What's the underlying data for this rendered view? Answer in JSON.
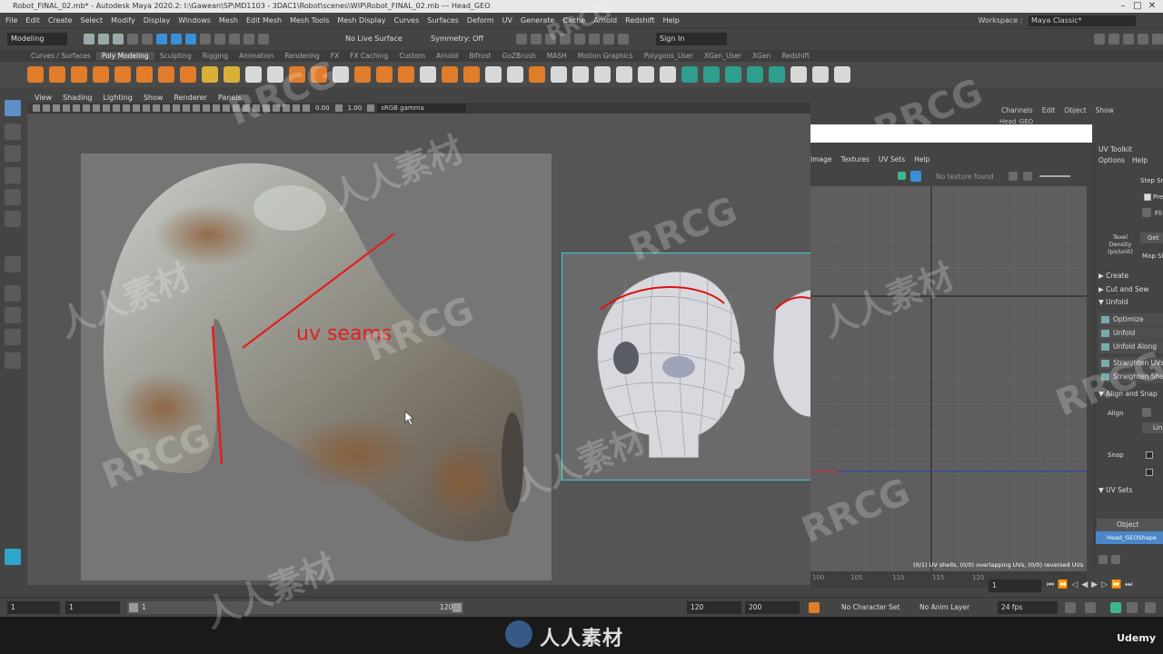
{
  "window": {
    "title": "Robot_FINAL_02.mb* - Autodesk Maya 2020.2: I:\\Gawean\\SP\\MD1103 - 3DAC1\\Robot\\scenes\\WIP\\Robot_FINAL_02.mb --- Head_GEO"
  },
  "menubar": {
    "items": [
      "File",
      "Edit",
      "Create",
      "Select",
      "Modify",
      "Display",
      "Windows",
      "Mesh",
      "Edit Mesh",
      "Mesh Tools",
      "Mesh Display",
      "Curves",
      "Surfaces",
      "Deform",
      "UV",
      "Generate",
      "Cache",
      "Arnold",
      "Redshift",
      "Help"
    ],
    "workspace_label": "Workspace :",
    "workspace_value": "Maya Classic*"
  },
  "statusline": {
    "mode": "Modeling",
    "live_surface": "No Live Surface",
    "symmetry": "Symmetry: Off",
    "sign_in": "Sign In"
  },
  "shelf": {
    "tabs": [
      "Curves / Surfaces",
      "Poly Modeling",
      "Sculpting",
      "Rigging",
      "Animation",
      "Rendering",
      "FX",
      "FX Caching",
      "Custom",
      "Arnold",
      "Bifrost",
      "GoZBrush",
      "MASH",
      "Motion Graphics",
      "Polygons_User",
      "XGen_User",
      "XGen",
      "Redshift"
    ],
    "active_tab": "Poly Modeling"
  },
  "viewport": {
    "menu": [
      "View",
      "Shading",
      "Lighting",
      "Show",
      "Renderer",
      "Panels"
    ],
    "exposure": "0.00",
    "gamma": "1.00",
    "color_space": "sRGB gamma",
    "annotation": "uv seams"
  },
  "channel_box": {
    "tabs": [
      "Channels",
      "Edit",
      "Object",
      "Show"
    ],
    "object": "Head_GEO"
  },
  "uv_editor": {
    "menu": [
      "Image",
      "Textures",
      "UV Sets",
      "Help"
    ],
    "texture_status": "No texture found",
    "status": "(0/1) UV shells, (0/0) overlapping UVs, (0/0) reversed UVs",
    "ruler": [
      "100",
      "105",
      "110",
      "115",
      "120"
    ]
  },
  "uv_toolkit": {
    "title": "UV Toolkit",
    "menu": [
      "Options",
      "Help"
    ],
    "step_snap": "Step Sn",
    "preview": "Prev",
    "flip": "Fli",
    "texel_label": "Texel Density (px/unit)",
    "get": "Get",
    "map_size": "Map Si",
    "sections": [
      "Create",
      "Cut and Sew",
      "Unfold"
    ],
    "unfold_items": [
      "Optimize",
      "Unfold",
      "Unfold Along",
      "Straighten UVs",
      "Straighten Shell"
    ],
    "align_section": "Align and Snap",
    "align_label": "Align",
    "lin": "Lin",
    "snap_label": "Snap",
    "uvsets_section": "UV Sets",
    "uvsets_header": "Object",
    "uvsets_selected": "Head_GEOShape"
  },
  "timeline": {
    "current": "1",
    "range_start": "1",
    "slider_start": "1",
    "slider_end": "120",
    "range_end": "120",
    "anim_end": "200",
    "character_set": "No Character Set",
    "anim_layer": "No Anim Layer",
    "fps": "24 fps",
    "frame_field": "1"
  },
  "watermark": {
    "text": "RRCG",
    "cn": "人人素材"
  },
  "footer": {
    "center": "人人素材",
    "brand": "Udemy"
  }
}
